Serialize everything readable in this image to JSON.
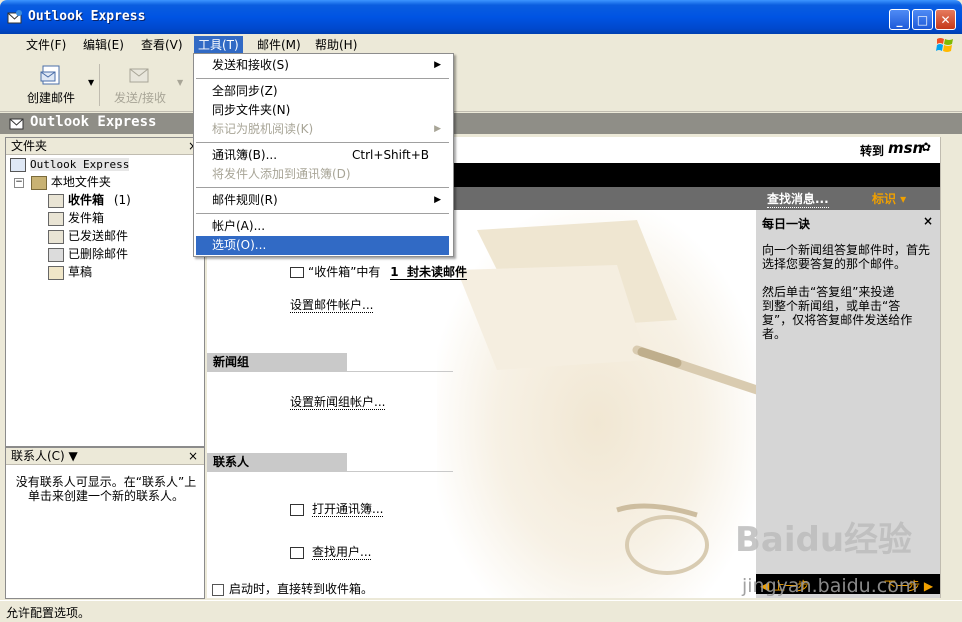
{
  "window": {
    "title": "Outlook Express"
  },
  "menubar": [
    {
      "label": "文件(F)"
    },
    {
      "label": "编辑(E)"
    },
    {
      "label": "查看(V)"
    },
    {
      "label": "工具(T)"
    },
    {
      "label": "邮件(M)"
    },
    {
      "label": "帮助(H)"
    }
  ],
  "toolbar": {
    "create_mail": "创建邮件",
    "send_receive": "发送/接收"
  },
  "folder_band": {
    "title": "Outlook Express"
  },
  "folders": {
    "header": "文件夹",
    "root": "Outlook Express",
    "local": "本地文件夹",
    "items": [
      {
        "label": "收件箱",
        "count": "(1)"
      },
      {
        "label": "发件箱"
      },
      {
        "label": "已发送邮件"
      },
      {
        "label": "已删除邮件"
      },
      {
        "label": "草稿"
      }
    ]
  },
  "contacts": {
    "header": "联系人(C) ▼",
    "message_line1": "没有联系人可显示。在“联系人”上",
    "message_line2": "单击来创建一个新的联系人。"
  },
  "main": {
    "goto": "转到",
    "msn": "msn",
    "find_message": "查找消息...",
    "identity": "标识 ▾",
    "inbox_prefix": "“收件箱”中有",
    "unread_count": "1",
    "unread_suffix": "封未读邮件",
    "setup_mail_account": "设置邮件帐户...",
    "newsgroups_header": "新闻组",
    "setup_news_account": "设置新闻组帐户...",
    "contacts_header": "联系人",
    "open_address_book": "打开通讯簿...",
    "find_people": "查找用户...",
    "startup_checkbox": "启动时，直接转到收件箱。"
  },
  "tip": {
    "title": "每日一诀",
    "para1_line1": "向一个新闻组答复邮件时，首先",
    "para1_line2": "选择您要答复的那个邮件。",
    "para2_line1": "然后单击“答复组”来投递",
    "para2_line2": "到整个新闻组，或单击“答",
    "para2_line3": "复”，仅将答复邮件发送给作",
    "para2_line4": "者。",
    "prev": "◀ 上一步",
    "next": "下一步 ▶"
  },
  "tools_menu": {
    "items": [
      {
        "label": "发送和接收(S)",
        "submenu": true
      },
      {
        "label": "全部同步(Z)"
      },
      {
        "label": "同步文件夹(N)"
      },
      {
        "label": "标记为脱机阅读(K)",
        "disabled": true,
        "submenu": true
      },
      {
        "label": "通讯簿(B)...",
        "accel": "Ctrl+Shift+B"
      },
      {
        "label": "将发件人添加到通讯簿(D)",
        "disabled": true
      },
      {
        "label": "邮件规则(R)",
        "submenu": true
      },
      {
        "label": "帐户(A)..."
      },
      {
        "label": "选项(O)...",
        "selected": true
      }
    ]
  },
  "status": {
    "text": "允许配置选项。"
  },
  "watermark": {
    "brand": "Baidu经验",
    "url": "jingyan.baidu.com"
  },
  "colors": {
    "titlebar": "#0054e3",
    "selection": "#316ac5",
    "identity": "#f0a000"
  }
}
